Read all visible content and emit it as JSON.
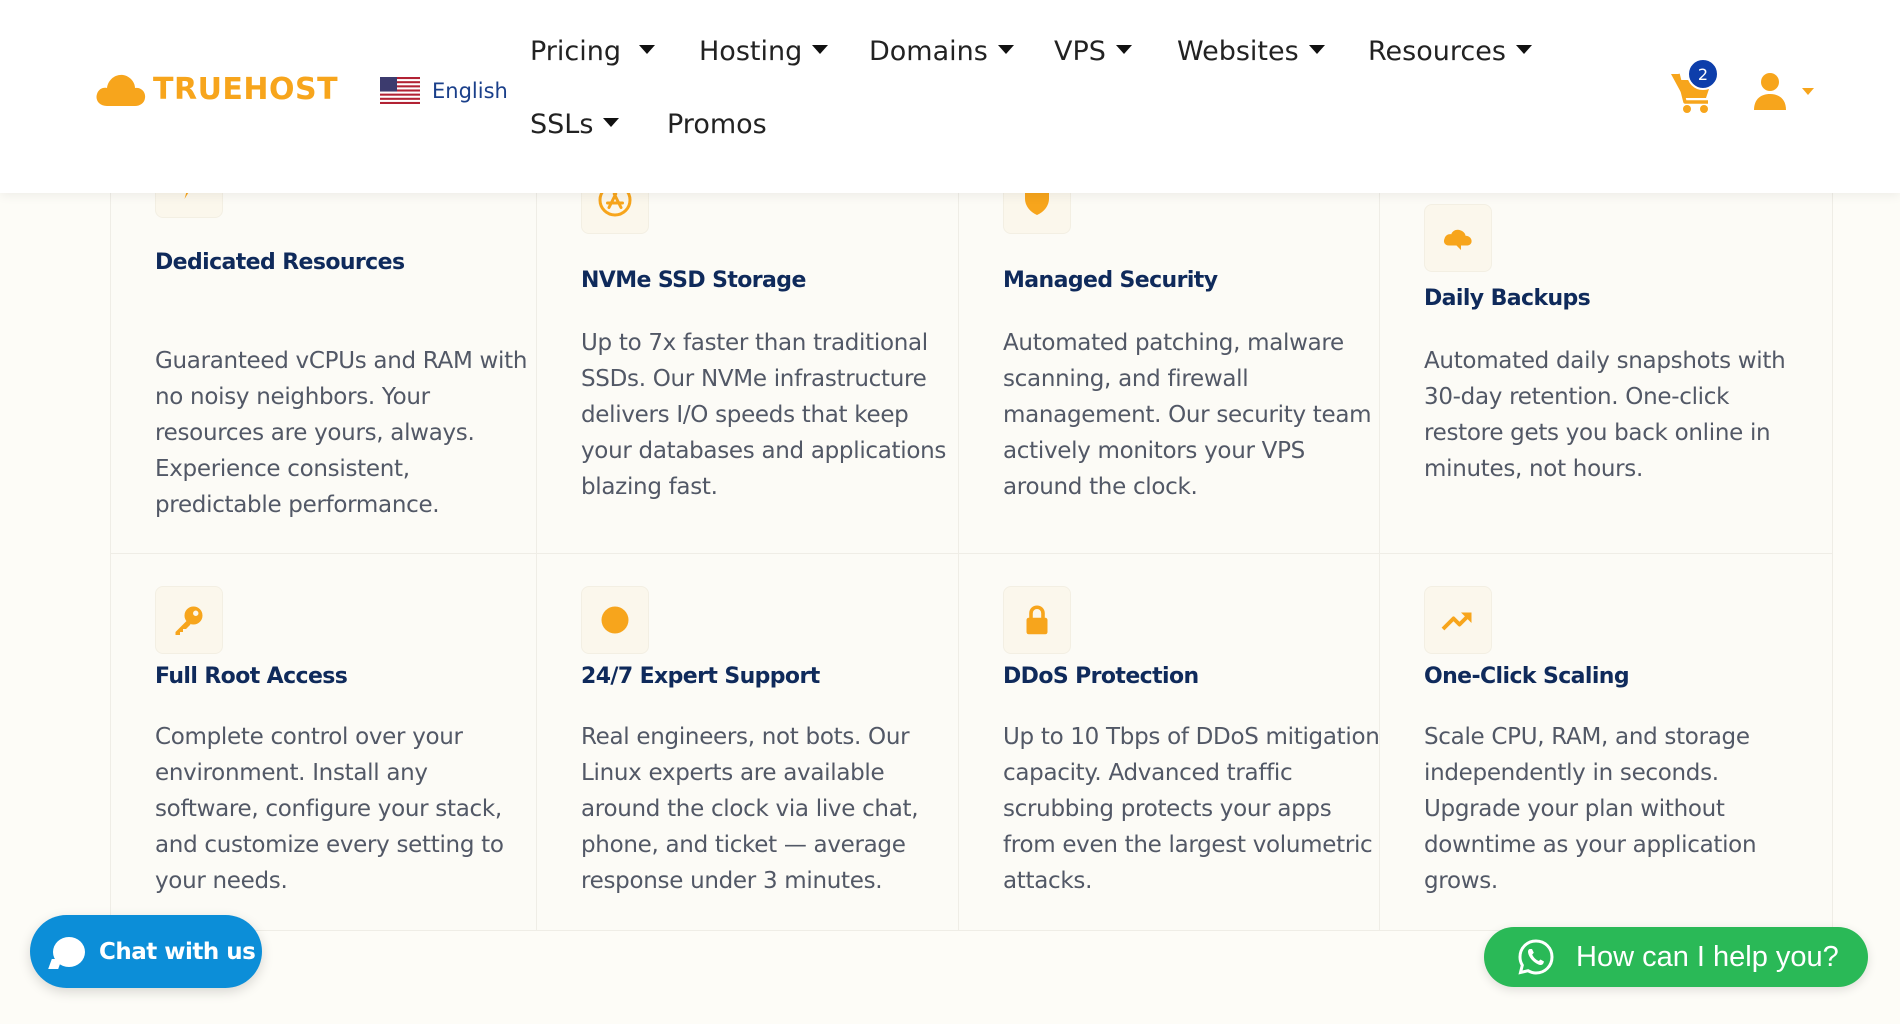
{
  "header": {
    "logo_text": "TRUEHOST",
    "language_label": "English",
    "nav": {
      "pricing": "Pricing",
      "hosting": "Hosting",
      "domains": "Domains",
      "vps": "VPS",
      "websites": "Websites",
      "resources": "Resources",
      "ssls": "SSLs",
      "promos": "Promos"
    },
    "cart_count": "2"
  },
  "colors": {
    "accent": "#f7a51c",
    "title": "#0f2a5b",
    "body_text": "#525866",
    "chat_blue": "#0c8ed8",
    "whatsapp_green": "#2ab957",
    "badge_blue": "#0d3eab"
  },
  "features": [
    {
      "icon": "lightning-icon",
      "title": "Dedicated Resources",
      "description": "Guaranteed vCPUs and RAM with no noisy neighbors. Your resources are yours, always. Experience consistent, predictable performance."
    },
    {
      "icon": "app-store-icon",
      "title": "NVMe SSD Storage",
      "description": "Up to 7x faster than traditional SSDs. Our NVMe infrastructure delivers I/O speeds that keep your databases and applications blazing fast."
    },
    {
      "icon": "shield-icon",
      "title": "Managed Security",
      "description": "Automated patching, malware scanning, and firewall management. Our security team actively monitors your VPS around the clock."
    },
    {
      "icon": "cloud-backup-icon",
      "title": "Daily Backups",
      "description": "Automated daily snapshots with 30-day retention. One-click restore gets you back online in minutes, not hours."
    },
    {
      "icon": "key-icon",
      "title": "Full Root Access",
      "description": "Complete control over your environment. Install any software, configure your stack, and customize every setting to your needs."
    },
    {
      "icon": "support-circle-icon",
      "title": "24/7 Expert Support",
      "description": "Real engineers, not bots. Our Linux experts are available around the clock via live chat, phone, and ticket — average response under 3 minutes."
    },
    {
      "icon": "lock-icon",
      "title": "DDoS Protection",
      "description": "Up to 10 Tbps of DDoS mitigation capacity. Advanced traffic scrubbing protects your apps from even the largest volumetric attacks."
    },
    {
      "icon": "trending-up-icon",
      "title": "One-Click Scaling",
      "description": "Scale CPU, RAM, and storage independently in seconds. Upgrade your plan without downtime as your application grows."
    }
  ],
  "chat": {
    "label": "Chat with us"
  },
  "whatsapp": {
    "label": "How can I help you?"
  }
}
